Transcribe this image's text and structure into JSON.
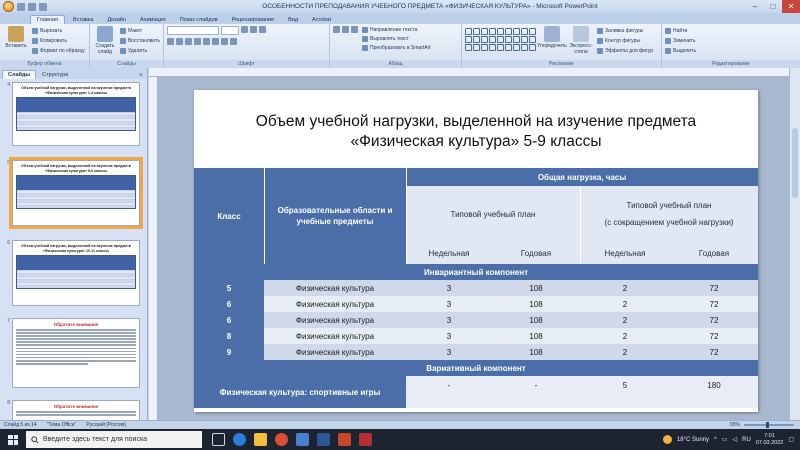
{
  "window": {
    "title": "ОСОБЕННОСТИ ПРЕПОДАВАНИЯ УЧЕБНОГО ПРЕДМЕТА «ФИЗИЧЕСКАЯ КУЛЬТУРА» - Microsoft PowerPoint",
    "minimize": "–",
    "maximize": "□",
    "close": "✕"
  },
  "ribbon": {
    "tabs": [
      "Главная",
      "Вставка",
      "Дизайн",
      "Анимация",
      "Показ слайдов",
      "Рецензирование",
      "Вид",
      "Acrobat"
    ],
    "active_tab": "Главная",
    "groups": {
      "clipboard": {
        "label": "Буфер обмена",
        "paste": "Вставить",
        "cut": "Вырезать",
        "copy": "Копировать",
        "format_painter": "Формат по образцу"
      },
      "slides": {
        "label": "Слайды",
        "new_slide": "Создать слайд",
        "layout": "Макет",
        "reset": "Восстановить",
        "delete": "Удалить"
      },
      "font": {
        "label": "Шрифт"
      },
      "paragraph": {
        "label": "Абзац",
        "text_direction": "Направление текста",
        "align_text": "Выровнять текст",
        "smartart": "Преобразовать в SmartArt"
      },
      "drawing": {
        "label": "Рисование",
        "arrange": "Упорядочить",
        "quick_styles": "Экспресс-стили",
        "shape_fill": "Заливка фигуры",
        "shape_outline": "Контур фигуры",
        "shape_effects": "Эффекты для фигур"
      },
      "editing": {
        "label": "Редактирование",
        "find": "Найти",
        "replace": "Заменить",
        "select": "Выделить"
      }
    }
  },
  "left_panel": {
    "tabs": [
      "Слайды",
      "Структура"
    ],
    "active_tab": "Слайды",
    "close": "×",
    "thumbnails": [
      {
        "number": "4",
        "title": "Объем учебной нагрузки, выделенной на изучение предмета «Физическая культура» 1-4 классы"
      },
      {
        "number": "5",
        "title": "Объем учебной нагрузки, выделенной на изучение предмета «Физическая культура» 5-9 классы"
      },
      {
        "number": "6",
        "title": "Объем учебной нагрузки, выделенной на изучение предмета «Физическая культура» 10-11 классы"
      },
      {
        "number": "7",
        "title": "Обратите внимание"
      },
      {
        "number": "8",
        "title": "Обратите внимание"
      }
    ]
  },
  "slide": {
    "title_line1": "Объем учебной нагрузки, выделенной на изучение предмета",
    "title_line2": "«Физическая культура» 5-9 классы",
    "table": {
      "col_class": "Класс",
      "col_subjects": "Образовательные области и учебные предметы",
      "col_total": "Общая нагрузка, часы",
      "col_typical": "Типовой учебный план",
      "col_reduced_line1": "Типовой учебный план",
      "col_reduced_line2": "(с сокращением учебной нагрузки)",
      "weekly": "Недельная",
      "yearly": "Годовая",
      "band_invariant": "Инвариантный компонент",
      "band_variative": "Вариативный компонент",
      "rows": [
        {
          "grade": "5",
          "subject": "Физическая культура",
          "typ_week": "3",
          "typ_year": "108",
          "red_week": "2",
          "red_year": "72"
        },
        {
          "grade": "6",
          "subject": "Физическая культура",
          "typ_week": "3",
          "typ_year": "108",
          "red_week": "2",
          "red_year": "72"
        },
        {
          "grade": "6",
          "subject": "Физическая культура",
          "typ_week": "3",
          "typ_year": "108",
          "red_week": "2",
          "red_year": "72"
        },
        {
          "grade": "8",
          "subject": "Физическая культура",
          "typ_week": "3",
          "typ_year": "108",
          "red_week": "2",
          "red_year": "72"
        },
        {
          "grade": "9",
          "subject": "Физическая культура",
          "typ_week": "3",
          "typ_year": "108",
          "red_week": "2",
          "red_year": "72"
        }
      ],
      "variative_row": {
        "subject": "Физическая культура: спортивные игры",
        "typ_week": "-",
        "typ_year": "-",
        "red_week": "5",
        "red_year": "180"
      }
    }
  },
  "status_bar": {
    "slide_info": "Слайд 5 из 14",
    "theme": "\"Тема Office\"",
    "language": "Русский (Россия)",
    "zoom": "65%"
  },
  "taskbar": {
    "search_placeholder": "Введите здесь текст для поиска",
    "weather": "18°C Sunny",
    "language": "RU",
    "time": "7:01",
    "date": "07.03.2022"
  },
  "colors": {
    "table_header": "#4b6ea9",
    "row_dark": "#cfd9ea",
    "row_light": "#e8edf5",
    "selection": "#f4a646"
  }
}
